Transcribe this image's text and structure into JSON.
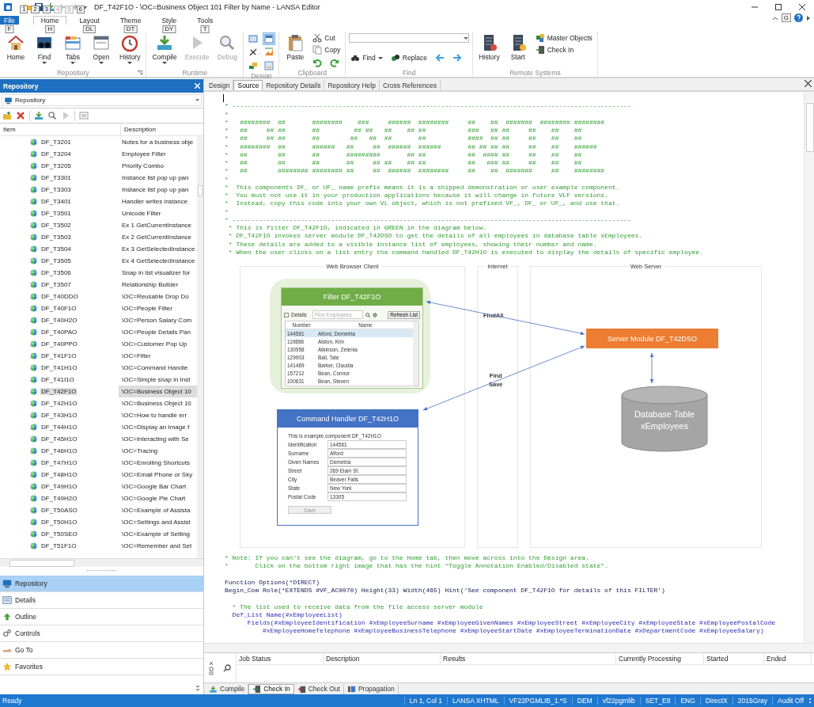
{
  "window": {
    "title": "DF_T42F1O - \\OC=Business Object 101 Filter by Name - LANSA Editor",
    "quick_access_keytips": [
      {
        "label": "1",
        "disabled": false
      },
      {
        "label": "2",
        "disabled": false
      },
      {
        "label": "3",
        "disabled": false
      },
      {
        "label": "4",
        "disabled": true
      },
      {
        "label": "5",
        "disabled": true
      },
      {
        "label": "6",
        "disabled": false
      }
    ],
    "help_keytip": "G"
  },
  "ribbon": {
    "tabs": [
      {
        "label": "File",
        "keytip": "F",
        "kind": "file",
        "selected": false
      },
      {
        "label": "Home",
        "keytip": "H",
        "kind": "tab",
        "selected": true
      },
      {
        "label": "Layout",
        "keytip": "DL",
        "kind": "tab",
        "selected": false
      },
      {
        "label": "Theme",
        "keytip": "DT",
        "kind": "tab",
        "selected": false
      },
      {
        "label": "Style",
        "keytip": "DY",
        "kind": "tab",
        "selected": false
      },
      {
        "label": "Tools",
        "keytip": "T",
        "kind": "tab",
        "selected": false
      }
    ],
    "groups": [
      {
        "label": "Repository",
        "launcher": true,
        "columns": [
          [
            {
              "kind": "large",
              "label": "Home",
              "dropdown": false,
              "disabled": false
            }
          ],
          [
            {
              "kind": "large",
              "label": "Find",
              "dropdown": true,
              "disabled": false
            }
          ],
          [
            {
              "kind": "large",
              "label": "Tabs",
              "dropdown": true,
              "disabled": false
            }
          ],
          [
            {
              "kind": "large",
              "label": "Open",
              "dropdown": true,
              "disabled": false
            }
          ],
          [
            {
              "kind": "large",
              "label": "History",
              "dropdown": true,
              "disabled": false
            }
          ]
        ]
      },
      {
        "label": "Runtime",
        "launcher": false,
        "columns": [
          [
            {
              "kind": "large",
              "label": "Compile",
              "dropdown": true,
              "disabled": false
            }
          ],
          [
            {
              "kind": "large",
              "label": "Execute",
              "dropdown": false,
              "disabled": true
            }
          ],
          [
            {
              "kind": "large",
              "label": "Debug",
              "dropdown": false,
              "disabled": true
            }
          ]
        ]
      },
      {
        "label": "Design",
        "launcher": false,
        "columns": [
          [
            {
              "kind": "tool",
              "selected": false
            },
            {
              "kind": "tool",
              "selected": false
            },
            {
              "kind": "tool",
              "selected": false
            }
          ],
          [
            {
              "kind": "tool",
              "selected": true
            },
            {
              "kind": "tool",
              "selected": false
            },
            {
              "kind": "tool",
              "selected": false
            }
          ]
        ]
      },
      {
        "label": "Clipboard",
        "launcher": false,
        "columns": [
          [
            {
              "kind": "large",
              "label": "Paste",
              "dropdown": false,
              "disabled": false
            }
          ],
          [
            {
              "kind": "small",
              "label": "Cut",
              "dropdown": false,
              "disabled": false
            },
            {
              "kind": "small",
              "label": "Copy",
              "dropdown": false,
              "disabled": false
            },
            {
              "kind": "row",
              "items": [
                {
                  "kind": "tool",
                  "selected": false
                },
                {
                  "kind": "tool",
                  "selected": false
                }
              ]
            }
          ]
        ]
      },
      {
        "label": "Find",
        "launcher": false,
        "columns": [
          [
            {
              "kind": "combo"
            },
            {
              "kind": "row",
              "items": [
                {
                  "kind": "small",
                  "label": "Find",
                  "dropdown": true,
                  "disabled": false
                },
                {
                  "kind": "small",
                  "label": "Replace",
                  "dropdown": false,
                  "disabled": false
                },
                {
                  "kind": "tool",
                  "selected": false
                },
                {
                  "kind": "tool",
                  "selected": false
                }
              ]
            }
          ]
        ]
      },
      {
        "label": "Remote Systems",
        "launcher": false,
        "columns": [
          [
            {
              "kind": "large",
              "label": "History",
              "dropdown": false,
              "disabled": false
            }
          ],
          [
            {
              "kind": "large",
              "label": "Start",
              "dropdown": false,
              "disabled": false
            }
          ],
          [
            {
              "kind": "small",
              "label": "Master Objects",
              "dropdown": false,
              "disabled": false
            },
            {
              "kind": "small",
              "label": "Check In",
              "dropdown": false,
              "disabled": false
            }
          ]
        ]
      }
    ]
  },
  "repository": {
    "title": "Repository",
    "selector": "Repository",
    "columns": [
      "Item",
      "Description"
    ],
    "rows": [
      {
        "item": "DF_T3201",
        "description": "Notes for a business obje",
        "selected": false
      },
      {
        "item": "DF_T3204",
        "description": "Employee Filter",
        "selected": false
      },
      {
        "item": "DF_T3205",
        "description": "Priority Combo",
        "selected": false
      },
      {
        "item": "DF_T3301",
        "description": "Instance list pop up pan",
        "selected": false
      },
      {
        "item": "DF_T3303",
        "description": "Instance list pop up pan",
        "selected": false
      },
      {
        "item": "DF_T3401",
        "description": "Handler writes instance",
        "selected": false
      },
      {
        "item": "DF_T3501",
        "description": "Unicode Filter",
        "selected": false
      },
      {
        "item": "DF_T3502",
        "description": "Ex 1 GetCurrentInstance",
        "selected": false
      },
      {
        "item": "DF_T3503",
        "description": "Ex 2 GetCurrentInstance",
        "selected": false
      },
      {
        "item": "DF_T3504",
        "description": "Ex 3 GetSelectedInstance",
        "selected": false
      },
      {
        "item": "DF_T3505",
        "description": "Ex 4 GetSelectedInstance",
        "selected": false
      },
      {
        "item": "DF_T3506",
        "description": "Snap in list visualizer for",
        "selected": false
      },
      {
        "item": "DF_T3507",
        "description": "Relationship Builder",
        "selected": false
      },
      {
        "item": "DF_T40DDO",
        "description": "\\OC=Reusable Drop Do",
        "selected": false
      },
      {
        "item": "DF_T40F1O",
        "description": "\\OC=People Filter",
        "selected": false
      },
      {
        "item": "DF_T40H2O",
        "description": "\\OC=Person Salary Com",
        "selected": false
      },
      {
        "item": "DF_T40PAO",
        "description": "\\OC=People Details Pan",
        "selected": false
      },
      {
        "item": "DF_T40PPO",
        "description": "\\OC=Customer Pop Up",
        "selected": false
      },
      {
        "item": "DF_T41F1O",
        "description": "\\OC=Filter",
        "selected": false
      },
      {
        "item": "DF_T41H1O",
        "description": "\\OC=Command Handle",
        "selected": false
      },
      {
        "item": "DF_T41I1O",
        "description": "\\OC=Simple snap in Inst",
        "selected": false
      },
      {
        "item": "DF_T42F1O",
        "description": "\\OC=Business Object 10",
        "selected": true
      },
      {
        "item": "DF_T42H1O",
        "description": "\\OC=Business Object 10",
        "selected": false
      },
      {
        "item": "DF_T43H1O",
        "description": "\\OC=How to handle err",
        "selected": false
      },
      {
        "item": "DF_T44H1O",
        "description": "\\OC=Display an Image f",
        "selected": false
      },
      {
        "item": "DF_T45H1O",
        "description": "\\OC=Interacting with Se",
        "selected": false
      },
      {
        "item": "DF_T46H1O",
        "description": "\\OC=Tracing",
        "selected": false
      },
      {
        "item": "DF_T47H1O",
        "description": "\\OC=Enrolling Shortcuts",
        "selected": false
      },
      {
        "item": "DF_T48H1O",
        "description": "\\OC=Email Phone or Sky",
        "selected": false
      },
      {
        "item": "DF_T49H1O",
        "description": "\\OC=Google Bar Chart",
        "selected": false
      },
      {
        "item": "DF_T49H2O",
        "description": "\\OC=Google Pie Chart",
        "selected": false
      },
      {
        "item": "DF_T50ASO",
        "description": "\\OC=Example of Assista",
        "selected": false
      },
      {
        "item": "DF_T50H1O",
        "description": "\\OC=Settings and Assist",
        "selected": false
      },
      {
        "item": "DF_T50SEO",
        "description": "\\OC=Example of Setting",
        "selected": false
      },
      {
        "item": "DF_T51F1O",
        "description": "\\OC=Remember and Set",
        "selected": false
      }
    ],
    "nav": [
      {
        "label": "Repository",
        "selected": true
      },
      {
        "label": "Details",
        "selected": false
      },
      {
        "label": "Outline",
        "selected": false
      },
      {
        "label": "Controls",
        "selected": false
      },
      {
        "label": "Go To",
        "selected": false
      },
      {
        "label": "Favorites",
        "selected": false
      }
    ]
  },
  "editor": {
    "tabs": [
      {
        "label": "Design",
        "selected": false
      },
      {
        "label": "Source",
        "selected": true
      },
      {
        "label": "Repository Details",
        "selected": false
      },
      {
        "label": "Repository Help",
        "selected": false
      },
      {
        "label": "Cross References",
        "selected": false
      }
    ],
    "code_before": [
      {
        "kind": "blank",
        "cursor": true
      },
      {
        "kind": "comment",
        "text": "* ---------------------------------------------------------------------------------------------------------"
      },
      {
        "kind": "comment",
        "text": "*"
      },
      {
        "kind": "comment",
        "text": "*   ########  ##       ########    ###     ######  ########     ##    ##  #######  ######## ########"
      },
      {
        "kind": "comment",
        "text": "*   ##     ## ##       ##         ## ##   ##    ## ##           ###   ## ##     ##    ##    ##"
      },
      {
        "kind": "comment",
        "text": "*   ##     ## ##       ##        ##   ##  ##       ##           ####  ## ##     ##    ##    ##"
      },
      {
        "kind": "comment",
        "text": "*   ########  ##       ######   ##     ##  ######  ######       ## ## ## ##     ##    ##    ######"
      },
      {
        "kind": "comment",
        "text": "*   ##        ##       ##       #########       ## ##           ##  #### ##     ##    ##    ##"
      },
      {
        "kind": "comment",
        "text": "*   ##        ##       ##       ##     ## ##    ## ##           ##   ### ##     ##    ##    ##"
      },
      {
        "kind": "comment",
        "text": "*   ##        ######## ######## ##     ##  ######  ########     ##    ##  #######     ##    ########"
      },
      {
        "kind": "comment",
        "text": "*"
      },
      {
        "kind": "comment",
        "text": "*  This components DF_ or UF_ name prefix means it is a shipped demonstration or user example component."
      },
      {
        "kind": "comment",
        "text": "*  You must not use it in your production applications because it will change in future VLF versions."
      },
      {
        "kind": "comment",
        "text": "*  Instead, copy this code into your own VL object, which is not prefixed VF_, DF_ or UF_, and use that."
      },
      {
        "kind": "comment",
        "text": "*"
      },
      {
        "kind": "comment",
        "text": "* ---------------------------------------------------------------------------------------------------------"
      },
      {
        "kind": "comment",
        "text": " * This is filter DF_T42F1O, indicated in GREEN in the diagram below."
      },
      {
        "kind": "comment",
        "text": " * DF_T42F1O invokes server module DF_T42DSO to get the details of all employees in database table xEmployees."
      },
      {
        "kind": "comment",
        "text": " * These details are added to a visible instance list of employees, showing their number and name."
      },
      {
        "kind": "comment",
        "text": " * When the user clicks on a list entry the command handled DF_T42H1O is executed to display the details of specific employee."
      }
    ],
    "code_after": [
      {
        "kind": "comment",
        "text": "* Note: If you can’t see the diagram, go to the Home tab, then move across into the Design area."
      },
      {
        "kind": "comment",
        "text": "*       Click on the bottom right image that has the hint “Toggle Annotation Enabled/Disabled state”."
      },
      {
        "kind": "blank"
      },
      {
        "kind": "code",
        "text": "Function Options(*DIRECT)"
      },
      {
        "kind": "code",
        "text": "Begin_Com Role(*EXTENDS #VF_AC0070) Height(33) Width(465) Hint('See component DF_T42F1O for details of this FILTER')"
      },
      {
        "kind": "blank"
      },
      {
        "kind": "comment",
        "text": "  * The list used to receive data from the file access server module"
      },
      {
        "kind": "definition",
        "text": "  Def_List Name(#xEmployeeList)"
      },
      {
        "kind": "definition",
        "text": "      Fields(#xEmployeeIdentification #xEmployeeSurname #xEmployeeGivenNames #xEmployeeStreet #xEmployeeCity #xEmployeeState #xEmployeePostalCode"
      },
      {
        "kind": "definition",
        "text": "          #xEmployeeHomeTelephone #xEmployeeBusinessTelephone #xEmployeeStartDate #xEmployeeTerminationDate #xDepartmentCode #xEmployeeSalary)"
      }
    ],
    "diagram": {
      "zones": [
        "Web  Browser Client",
        "Internet",
        "Web Server"
      ],
      "filter_panel": {
        "title": "Filter DF_T42F1O",
        "details_label": "Details",
        "search_placeholder": "Find Employees",
        "refresh_button": "Refresh List",
        "columns": [
          "Number",
          "Name"
        ],
        "rows": [
          {
            "number": "144561",
            "name": "Alford, Demetria",
            "selected": true
          },
          {
            "number": "119886",
            "name": "Alston, Kim",
            "selected": false
          },
          {
            "number": "130958",
            "name": "Atkinson, Zelenia",
            "selected": false
          },
          {
            "number": "129903",
            "name": "Ball, Tate",
            "selected": false
          },
          {
            "number": "141469",
            "name": "Barker, Claudia",
            "selected": false
          },
          {
            "number": "157212",
            "name": "Bean, Connor",
            "selected": false
          },
          {
            "number": "100631",
            "name": "Bean, Steven",
            "selected": false
          }
        ]
      },
      "flows": [
        [
          "FindAll"
        ],
        [
          "Find",
          "Save"
        ]
      ],
      "server_module": "Server Module DF_T42DSO",
      "database": [
        "Database Table",
        "xEmployees"
      ],
      "command_handler": {
        "title": "Command Handler DF_T42H1O",
        "intro": "This is example component DF_T42H1O",
        "fields": [
          {
            "label": "Identification",
            "value": "144561"
          },
          {
            "label": "Surname",
            "value": "Alford"
          },
          {
            "label": "Given Names",
            "value": "Demetria"
          },
          {
            "label": "Street",
            "value": "269 Elam St."
          },
          {
            "label": "City",
            "value": "Beaver Falls"
          },
          {
            "label": "State",
            "value": "New York"
          },
          {
            "label": "Postal Code",
            "value": "13305"
          }
        ],
        "button": "Save"
      }
    }
  },
  "job_panel": {
    "columns": [
      "Job Status",
      "Description",
      "Results",
      "Currently Processing",
      "Started",
      "Ended"
    ]
  },
  "bottom_tabs": [
    {
      "label": "Compile",
      "selected": false
    },
    {
      "label": "Check In",
      "selected": true
    },
    {
      "label": "Check Out",
      "selected": false
    },
    {
      "label": "Propagation",
      "selected": false
    }
  ],
  "status_bar": {
    "message": "Ready",
    "fields": [
      "Ln 1, Col 1",
      "LANSA XHTML",
      "VF22PGMLIB_1.*S",
      "DEM",
      "vf22pgmlib",
      "SET_E8",
      "ENG",
      "DirectX",
      "2015Gray",
      "Audit Off"
    ]
  }
}
